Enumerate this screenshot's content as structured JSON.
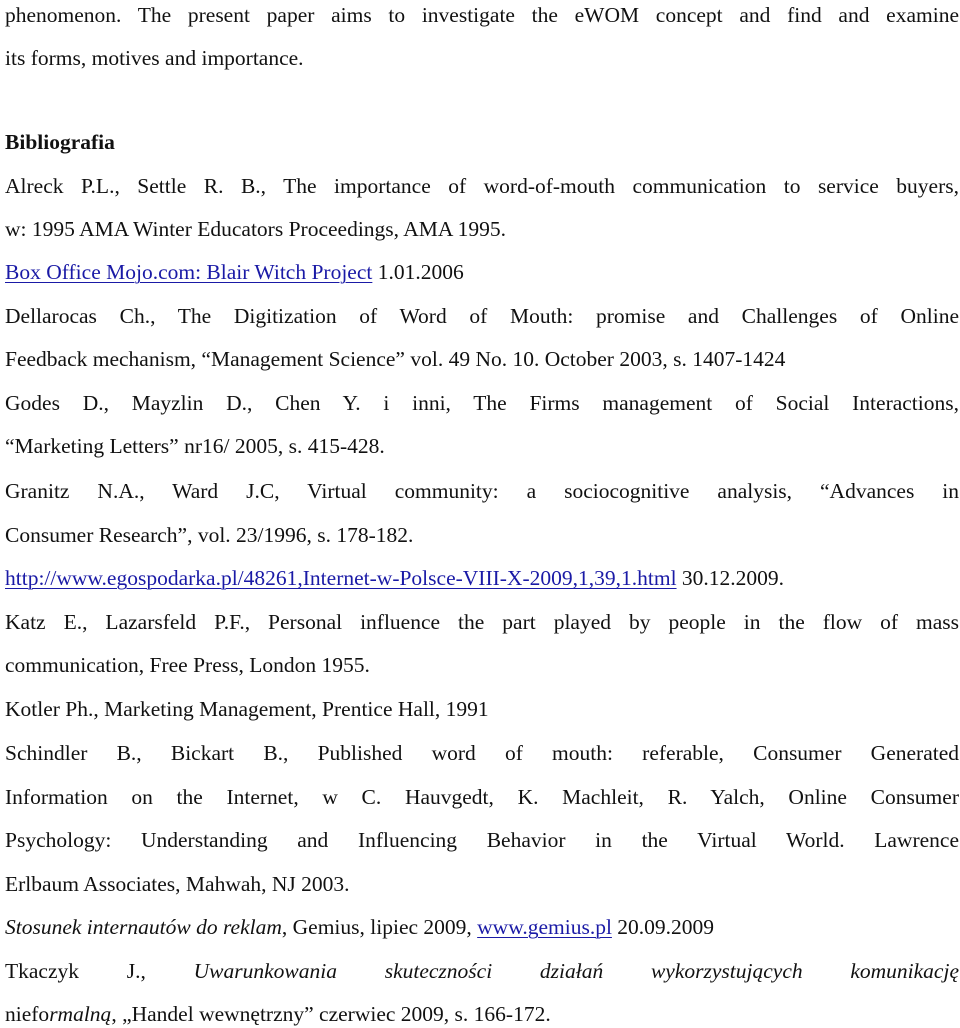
{
  "intro": {
    "line1": "phenomenon. The present paper aims to investigate the eWOM concept and find and examine",
    "line2": "its forms, motives and importance."
  },
  "bibliography": {
    "heading": "Bibliografia",
    "entries": [
      {
        "line1": "Alreck P.L., Settle R. B., The importance of word-of-mouth communication to service buyers,",
        "line2": "w: 1995 AMA Winter Educators Proceedings, AMA 1995."
      },
      {
        "link": "Box Office Mojo.com: Blair Witch Project",
        "after": " 1.01.2006"
      },
      {
        "line1": "Dellarocas Ch., The Digitization of Word of Mouth: promise and Challenges of Online",
        "line2": "Feedback mechanism, “Management Science” vol. 49 No. 10. October 2003, s. 1407-1424"
      },
      {
        "line1": "Godes D., Mayzlin D., Chen Y. i inni, The Firms management of Social Interactions,",
        "line2": "“Marketing Letters” nr16/ 2005, s. 415-428."
      },
      {
        "line1": "Granitz N.A., Ward J.C, Virtual community: a sociocognitive analysis, “Advances in",
        "line2": "Consumer Research”, vol. 23/1996, s. 178-182."
      },
      {
        "link": "http://www.egospodarka.pl/48261,Internet-w-Polsce-VIII-X-2009,1,39,1.html",
        "after": " 30.12.2009."
      },
      {
        "line1": "Katz E., Lazarsfeld P.F., Personal influence the part played by people in the flow of mass",
        "line2": "communication, Free Press, London 1955."
      },
      {
        "line1": "Kotler Ph., Marketing Management, Prentice Hall, 1991"
      },
      {
        "line1": "Schindler B., Bickart B., Published word of mouth: referable, Consumer Generated",
        "line2": "Information on the Internet, w C. Hauvgedt, K. Machleit, R. Yalch, Online Consumer",
        "line3": "Psychology: Understanding and Influencing Behavior in the Virtual World. Lawrence",
        "line4": "Erlbaum Associates, Mahwah, NJ 2003."
      },
      {
        "italic": "Stosunek internautów do reklam",
        "middle": ", Gemius, lipiec 2009, ",
        "link": "www.gemius.pl",
        "after": " 20.09.2009"
      },
      {
        "author": "Tkaczyk J.,",
        "italic1": "Uwarunkowania skuteczności działań wykorzystujących komunikację",
        "prefix2": "niefo",
        "italic2": "rmalną",
        "after2": ", „Handel wewnętrzny” czerwiec 2009, s. 166-172."
      }
    ]
  },
  "colors": {
    "text": "#111111",
    "link": "#1a1aa6",
    "background": "#ffffff"
  }
}
